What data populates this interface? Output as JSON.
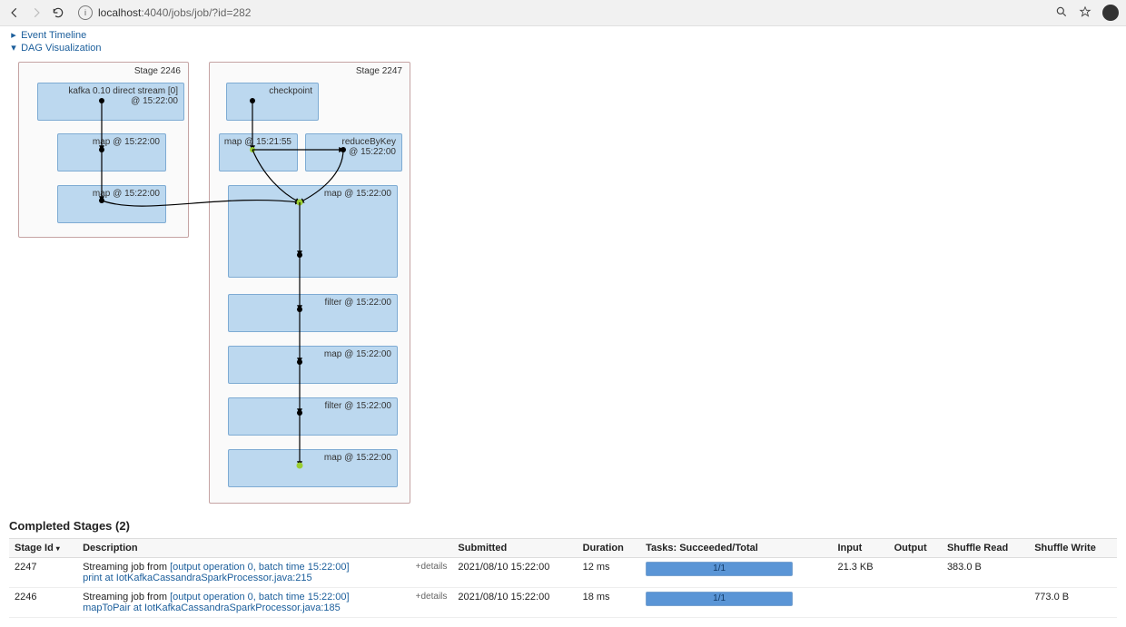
{
  "browser": {
    "url_host": "localhost",
    "url_port": ":4040",
    "url_path": "/jobs/job/?id=282"
  },
  "nav": {
    "event_timeline": "Event Timeline",
    "dag_viz": "DAG Visualization"
  },
  "dag": {
    "stage_left": {
      "title": "Stage 2246",
      "rdd0_l1": "kafka 0.10 direct stream [0]",
      "rdd0_l2": "@ 15:22:00",
      "rdd1": "map @ 15:22:00",
      "rdd2": "map @ 15:22:00"
    },
    "stage_right": {
      "title": "Stage 2247",
      "rdd_cp": "checkpoint",
      "rdd_map0": "map @ 15:21:55",
      "rdd_rbk_l1": "reduceByKey",
      "rdd_rbk_l2": "@ 15:22:00",
      "rdd_map1": "map @ 15:22:00",
      "rdd_filter1": "filter @ 15:22:00",
      "rdd_map2": "map @ 15:22:00",
      "rdd_filter2": "filter @ 15:22:00",
      "rdd_map3": "map @ 15:22:00"
    }
  },
  "completed": {
    "title": "Completed Stages (2)",
    "columns": {
      "stage_id": "Stage Id",
      "description": "Description",
      "submitted": "Submitted",
      "duration": "Duration",
      "tasks": "Tasks: Succeeded/Total",
      "input": "Input",
      "output": "Output",
      "shuffle_read": "Shuffle Read",
      "shuffle_write": "Shuffle Write"
    },
    "rows": [
      {
        "id": "2247",
        "desc_prefix": "Streaming job from ",
        "desc_link": "[output operation 0, batch time 15:22:00]",
        "desc_line2": "print at IotKafkaCassandraSparkProcessor.java:215",
        "details": "+details",
        "submitted": "2021/08/10 15:22:00",
        "duration": "12 ms",
        "tasks": "1/1",
        "input": "21.3 KB",
        "output": "",
        "shuffle_read": "383.0 B",
        "shuffle_write": ""
      },
      {
        "id": "2246",
        "desc_prefix": "Streaming job from ",
        "desc_link": "[output operation 0, batch time 15:22:00]",
        "desc_line2": "mapToPair at IotKafkaCassandraSparkProcessor.java:185",
        "details": "+details",
        "submitted": "2021/08/10 15:22:00",
        "duration": "18 ms",
        "tasks": "1/1",
        "input": "",
        "output": "",
        "shuffle_read": "",
        "shuffle_write": "773.0 B"
      }
    ]
  }
}
